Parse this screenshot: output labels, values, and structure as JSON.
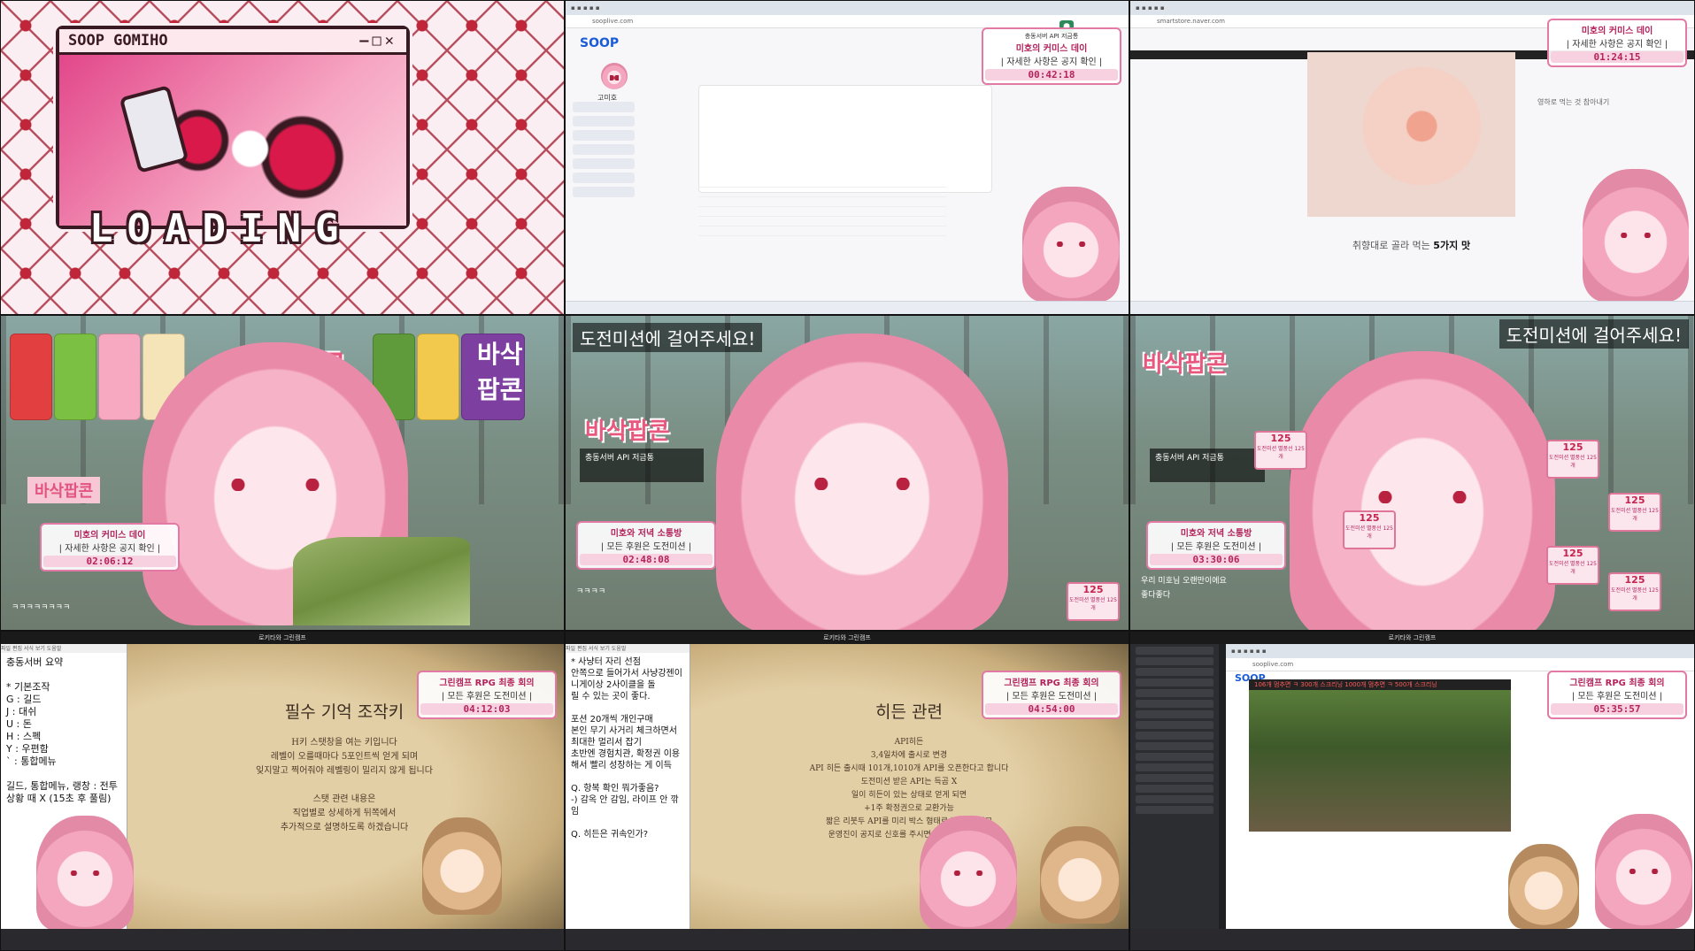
{
  "tile1": {
    "window_title": "SOOP GOMIHO",
    "window_controls": "—□✕",
    "loading": "LOADING"
  },
  "tile2": {
    "hud_title": "미호의 커미스 데이",
    "hud_sub": "| 자세한 사항은 공지 확인 |",
    "hud_timer": "00:42:18",
    "logo": "SOOP",
    "user_name": "고미호",
    "side_heading": "충동서버 API 저금통"
  },
  "tile3": {
    "hud_title": "미호의 커미스 데이",
    "hud_sub": "| 자세한 사항은 공지 확인 |",
    "hud_timer": "01:24:15",
    "caption_prefix": "취향대로 골라 먹는 ",
    "caption_bold": "5가지 맛",
    "note": "영하로 먹는 것 참아내기"
  },
  "tile4": {
    "title_left": "바삭팝콘",
    "title_right": "바삭 팝콘",
    "tag": "바삭팝콘",
    "hud_title": "미호의 커미스 데이",
    "hud_sub": "| 자세한 사항은 공지 확인 |",
    "hud_timer": "02:06:12",
    "chat": "ㅋㅋㅋㅋㅋㅋㅋㅋ"
  },
  "tile5": {
    "mission": "도전미션에 걸어주세요!",
    "title": "바삭팝콘",
    "savings": "충동서버 API 저금통",
    "hud_title": "미호와 저녁 소통방",
    "hud_sub": "| 모든 후원은 도전미션 |",
    "hud_timer": "02:48:08",
    "chat": "ㅋㅋㅋㅋ"
  },
  "tile6": {
    "mission": "도전미션에 걸어주세요!",
    "title": "바삭팝콘",
    "savings": "충동서버 API 저금통",
    "hud_title": "미호와 저녁 소통방",
    "hud_sub": "| 모든 후원은 도전미션 |",
    "hud_timer": "03:30:06",
    "chat1": "우리 미호님 오랜만이에요",
    "chat2": "좋다좋다",
    "gift_amount": "125",
    "gift_label": "도전미션 별풍선 125개"
  },
  "tile7": {
    "notepad_text": "충동서버 요약\n\n* 기본조작\nG : 길드\nJ : 대쉬\nU : 돈\nH : 스펙\nY : 우편함\n` : 통합메뉴\n\n길드, 통합메뉴, 랭창 : 전투상황 때 X (15초 후 풀림)",
    "parch_title": "필수 기억 조작키",
    "parch_lines": [
      "H키 스탯창을 여는 키입니다",
      "레벨이 오를때마다 5포인트씩 얻게 되며",
      "잊지말고 찍어줘야 레벨링이 밀리지 않게 됩니다",
      "",
      "스탯 관련 내용은",
      "직업별로 상세하게 뒤쪽에서",
      "추가적으로 설명하도록 하겠습니다"
    ],
    "hud_title": "그린캠프 RPG 최종 회의",
    "hud_sub": "| 모든 후원은 도전미션 |",
    "hud_timer": "04:12:03"
  },
  "tile8": {
    "notepad_text": "* 사냥터 자리 선점\n안쪽으로 들어가서 사냥강젠이 니게이상 2사이클을 돌\n릴 수 있는 곳이 좋다.\n\n포션 20개씩 개인구매\n본인 무기 사거리 체크하면서\n최대한 멀리서 잡기\n초반엔 경험치관, 확정권 이용해서 빨리 성장하는 게 이득\n\nQ. 항복 확인 뭐가좋음?\n-) 감옥 안 감임, 라이프 안 깎임\n\nQ. 히든은 귀속인가?",
    "parch_title": "히든 관련",
    "parch_lines": [
      "API히든",
      "3,4일차에 출시로 변경",
      "API 히든 출시때 101개,1010개 API를 오픈한다고 합니다",
      "도전미션 받은 API는 득곰 X",
      "일이 히든이 있는 상태로 얻게 되면",
      "+1주 확정권으로 교환가능",
      "짧은 리붓두 API를 미리 박스 형태로 받을 수 있고",
      "운영진이 공지로 신호를 주시면 다감이 개봉 시작"
    ],
    "hud_title": "그린캠프 RPG 최종 회의",
    "hud_sub": "| 모든 후원은 도전미션 |",
    "hud_timer": "04:54:00"
  },
  "tile9": {
    "logo": "SOOP",
    "game_banner": "106개 멈추면 ㅋ 300개 스크리닝 1000개 멈추면 ㅋ 500개 스크리닝",
    "hud_title": "그린캠프 RPG 최종 회의",
    "hud_sub": "| 모든 후원은 도전미션 |",
    "hud_timer": "05:35:57"
  },
  "colors": {
    "accent_pink": "#e27aa5",
    "timer_pink": "#b3245c",
    "soop_blue": "#1a5bd8"
  }
}
